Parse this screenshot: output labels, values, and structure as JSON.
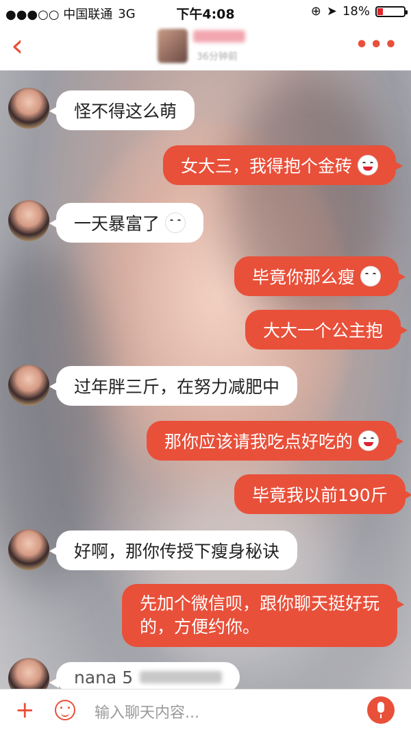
{
  "status": {
    "carrier": "●●●○○ 中国联通",
    "network": "3G",
    "time": "下午4:08",
    "battery": "18%"
  },
  "nav": {
    "subtitle": "36分钟前"
  },
  "messages": [
    {
      "side": "in",
      "text": "怪不得这么萌"
    },
    {
      "side": "out",
      "text": "女大三，我得抱个金砖"
    },
    {
      "side": "in",
      "text": "一天暴富了"
    },
    {
      "side": "out",
      "text": "毕竟你那么瘦"
    },
    {
      "side": "out",
      "text": "大大一个公主抱"
    },
    {
      "side": "in",
      "text": "过年胖三斤，在努力减肥中"
    },
    {
      "side": "out",
      "text": "那你应该请我吃点好吃的"
    },
    {
      "side": "out",
      "text": "毕竟我以前190斤"
    },
    {
      "side": "in",
      "text": "好啊，那你传授下瘦身秘诀"
    },
    {
      "side": "out",
      "text_line1": "先加个微信呗，跟你聊天挺好玩",
      "text_line2": "的，方便约你。"
    },
    {
      "side": "in",
      "text": "nana 5"
    }
  ],
  "input": {
    "placeholder": "输入聊天内容..."
  },
  "colors": {
    "accent": "#e8503a",
    "bubble_in": "#ffffff"
  },
  "icons": [
    "back-icon",
    "more-icon",
    "add-icon",
    "emoji-icon",
    "mic-icon"
  ]
}
